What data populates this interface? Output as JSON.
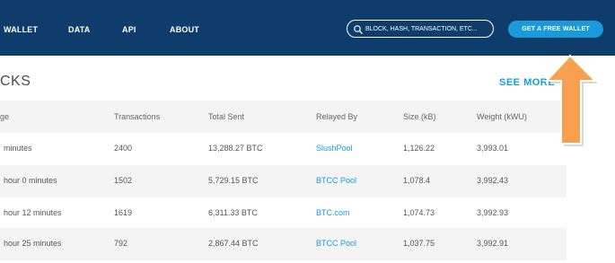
{
  "nav": {
    "items": [
      "WALLET",
      "DATA",
      "API",
      "ABOUT"
    ],
    "search_placeholder": "BLOCK, HASH, TRANSACTION, ETC...",
    "cta": "GET A FREE WALLET"
  },
  "section": {
    "title": "CKS",
    "see_more": "SEE MORE"
  },
  "table": {
    "headers": [
      "ge",
      "Transactions",
      "Total Sent",
      "Relayed By",
      "Size (kB)",
      "Weight (kWU)"
    ],
    "rows": [
      [
        "minutes",
        "2400",
        "13,288.27 BTC",
        "SlushPool",
        "1,126.22",
        "3,993.01"
      ],
      [
        "hour 0 minutes",
        "1502",
        "5,729.15 BTC",
        "BTCC Pool",
        "1,078.4",
        "3,992.43"
      ],
      [
        "hour 12 minutes",
        "1619",
        "6,311.33 BTC",
        "BTC.com",
        "1,074.73",
        "3,992.93"
      ],
      [
        "hour 25 minutes",
        "792",
        "2,867.44 BTC",
        "BTCC Pool",
        "1,037.75",
        "3,992.91"
      ]
    ]
  },
  "colors": {
    "nav_bg": "#0f3d6b",
    "accent": "#1a9bd8",
    "arrow_fill": "#f7a04f"
  }
}
